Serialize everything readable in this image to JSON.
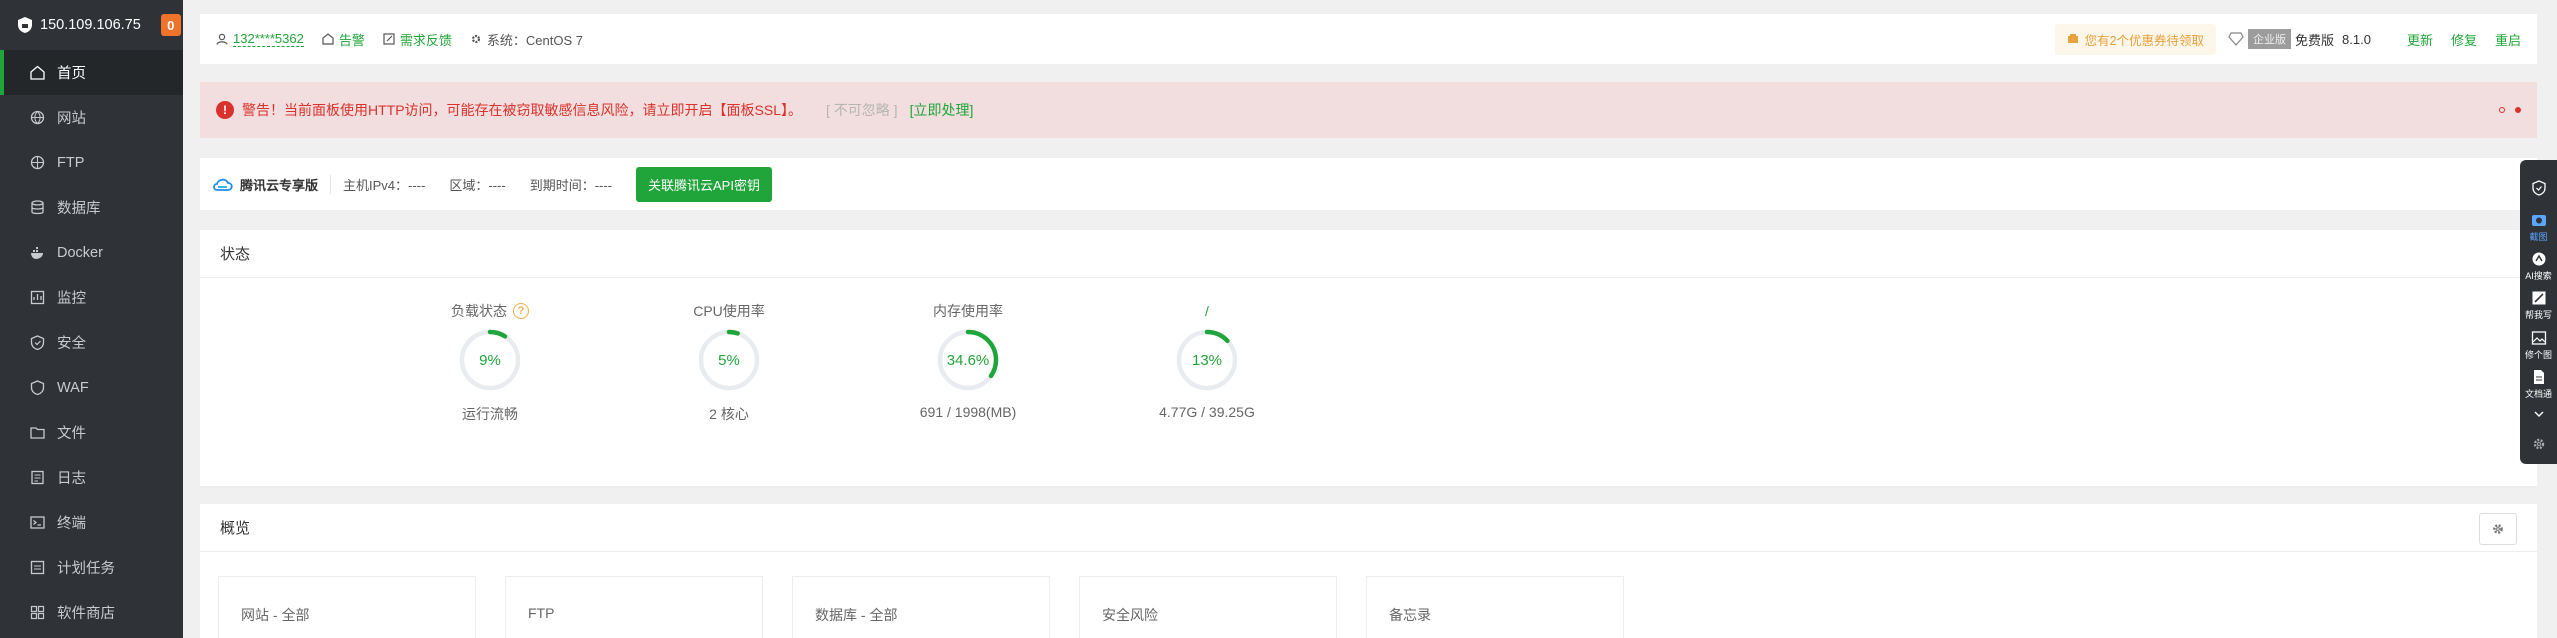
{
  "sidebar": {
    "server_ip": "150.109.106.75",
    "badge": "0",
    "items": [
      {
        "label": "首页",
        "icon": "home-icon",
        "active": true
      },
      {
        "label": "网站",
        "icon": "globe-icon"
      },
      {
        "label": "FTP",
        "icon": "ftp-icon"
      },
      {
        "label": "数据库",
        "icon": "database-icon"
      },
      {
        "label": "Docker",
        "icon": "docker-icon"
      },
      {
        "label": "监控",
        "icon": "monitor-icon"
      },
      {
        "label": "安全",
        "icon": "shield-icon"
      },
      {
        "label": "WAF",
        "icon": "waf-icon"
      },
      {
        "label": "文件",
        "icon": "folder-icon"
      },
      {
        "label": "日志",
        "icon": "log-icon"
      },
      {
        "label": "终端",
        "icon": "terminal-icon"
      },
      {
        "label": "计划任务",
        "icon": "clock-icon"
      },
      {
        "label": "软件商店",
        "icon": "store-icon"
      }
    ]
  },
  "topbar": {
    "user": "132****5362",
    "notice": "告警",
    "feedback": "需求反馈",
    "system": "系统：CentOS 7",
    "coupon": "您有2个优惠券待领取",
    "edition_tag": "企业版",
    "edition": "免费版",
    "version": "8.1.0",
    "update": "更新",
    "repair": "修复",
    "restart": "重启"
  },
  "alert": {
    "icon": "!",
    "message": "警告！当前面板使用HTTP访问，可能存在被窃取敏感信息风险，请立即开启【面板SSL】。",
    "ignore": "[ 不可忽略 ]",
    "handle": "[立即处理]"
  },
  "tencent": {
    "title": "腾讯云专享版",
    "ipv4": "主机IPv4：----",
    "region": "区域：----",
    "expire": "到期时间：----",
    "button": "关联腾讯云API密钥"
  },
  "status": {
    "title": "状态",
    "colors": {
      "accent": "#20a53a",
      "track": "#e8ecf1"
    },
    "gauges": [
      {
        "label": "负载状态",
        "value_text": "9%",
        "fraction": 0.09,
        "sub": "运行流畅",
        "help": "?"
      },
      {
        "label": "CPU使用率",
        "value_text": "5%",
        "fraction": 0.05,
        "sub": "2 核心"
      },
      {
        "label": "内存使用率",
        "value_text": "34.6%",
        "fraction": 0.346,
        "sub": "691 / 1998(MB)"
      },
      {
        "label": "/",
        "value_text": "13%",
        "fraction": 0.13,
        "sub": "4.77G / 39.25G"
      }
    ]
  },
  "overview": {
    "title": "概览",
    "cards": [
      "网站 - 全部",
      "FTP",
      "数据库 - 全部",
      "安全风险",
      "备忘录"
    ]
  },
  "right_toolbar": [
    {
      "label": "",
      "icon": "shield-check-icon"
    },
    {
      "label": "截图",
      "icon": "camera-icon",
      "selected": true
    },
    {
      "label": "AI搜索",
      "icon": "ai-search-icon"
    },
    {
      "label": "帮我写",
      "icon": "write-icon"
    },
    {
      "label": "修个图",
      "icon": "image-icon"
    },
    {
      "label": "文档通",
      "icon": "doc-icon"
    },
    {
      "label": "",
      "icon": "chevron-down-icon"
    },
    {
      "label": "",
      "icon": "settings-icon"
    }
  ]
}
